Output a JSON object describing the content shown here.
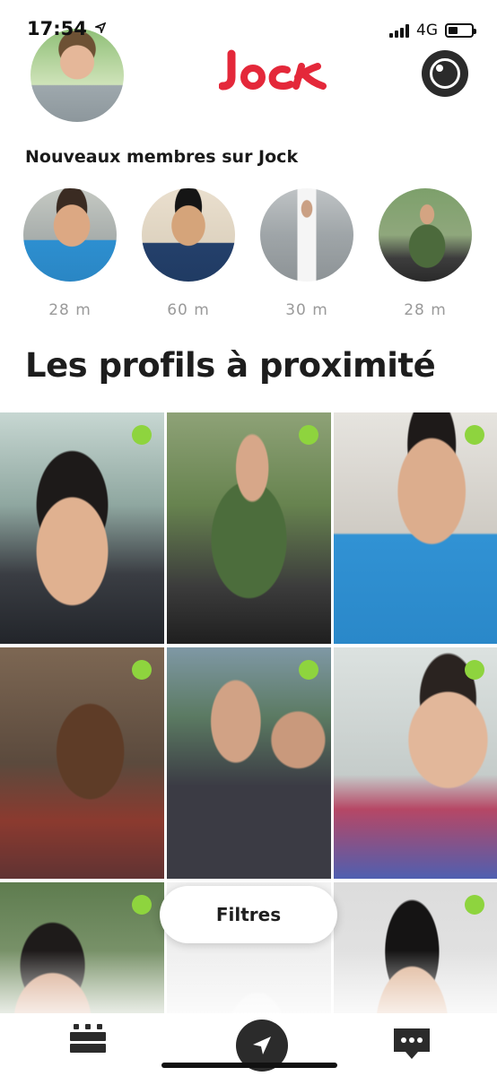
{
  "status_bar": {
    "time": "17:54",
    "network": "4G",
    "battery_level": 0.4
  },
  "header": {
    "logo_text": "Jock",
    "brand_color": "#e4283a"
  },
  "new_members": {
    "title": "Nouveaux membres sur Jock",
    "items": [
      {
        "distance": "28 m"
      },
      {
        "distance": "60 m"
      },
      {
        "distance": "30 m"
      },
      {
        "distance": "28 m"
      }
    ]
  },
  "nearby": {
    "title": "Les profils à proximité",
    "online_color": "#8ed43e",
    "profiles": [
      {
        "online": true
      },
      {
        "online": true
      },
      {
        "online": true
      },
      {
        "online": true
      },
      {
        "online": true
      },
      {
        "online": true
      },
      {
        "online": true
      },
      {
        "online": false
      },
      {
        "online": true
      }
    ]
  },
  "filter_button": {
    "label": "Filtres"
  },
  "tab_bar": {
    "items": [
      {
        "icon": "list-icon"
      },
      {
        "icon": "location-arrow-icon",
        "active": true
      },
      {
        "icon": "chat-bubble-icon"
      }
    ]
  }
}
